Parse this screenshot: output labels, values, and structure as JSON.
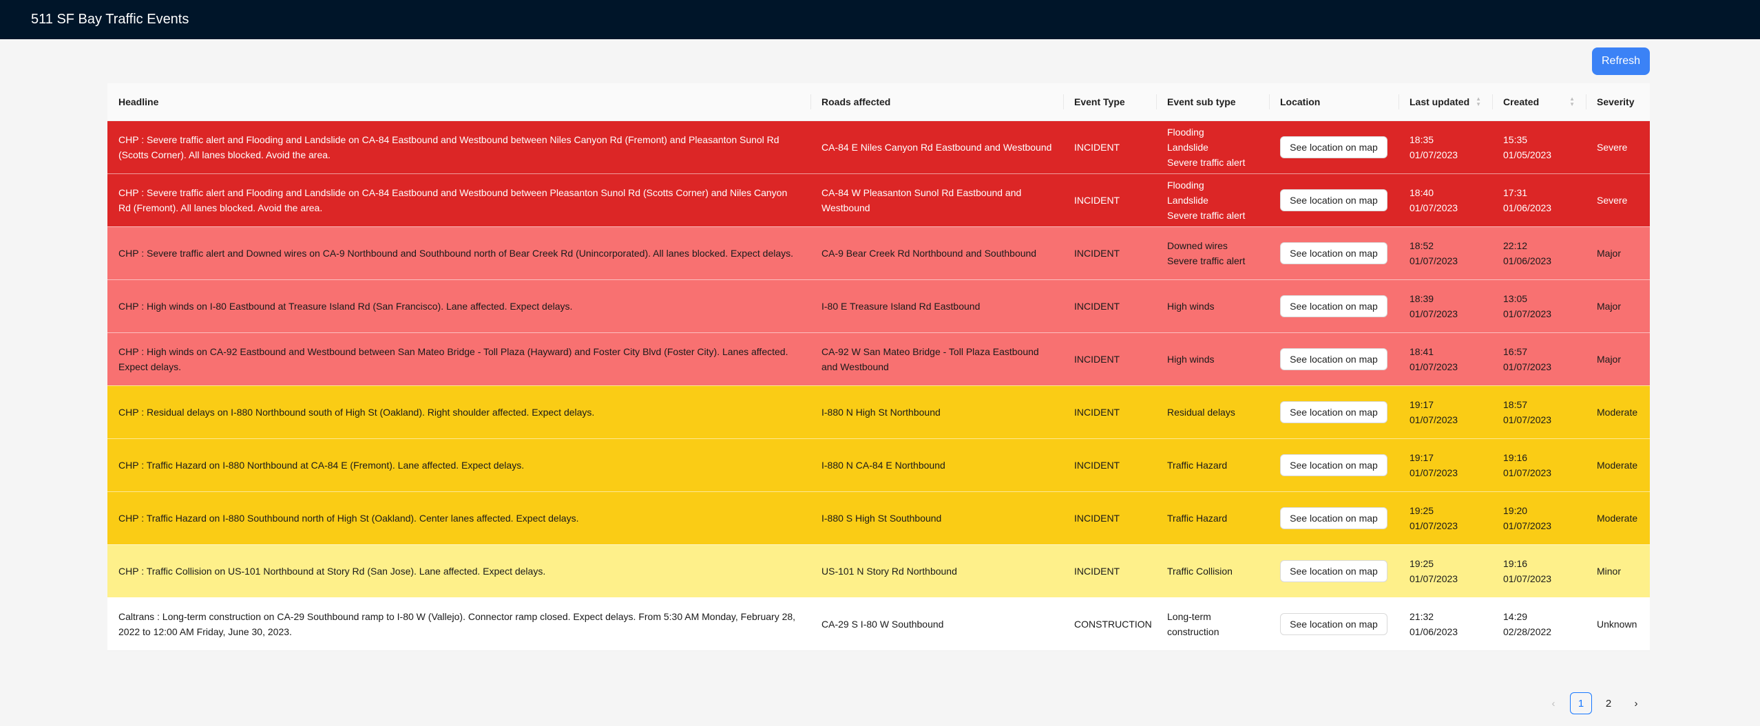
{
  "app": {
    "title": "511 SF Bay Traffic Events"
  },
  "toolbar": {
    "refresh_label": "Refresh"
  },
  "table": {
    "columns": [
      "Headline",
      "Roads affected",
      "Event Type",
      "Event sub type",
      "Location",
      "Last updated",
      "Created",
      "Severity"
    ],
    "map_button_label": "See location on map",
    "rows": [
      {
        "severity_class": "severe",
        "headline": "CHP : Severe traffic alert and Flooding and Landslide on CA-84 Eastbound and Westbound between Niles Canyon Rd (Fremont) and Pleasanton Sunol Rd (Scotts Corner). All lanes blocked. Avoid the area.",
        "roads": "CA-84 E Niles Canyon Rd Eastbound and Westbound",
        "event_type": "INCIDENT",
        "subtypes": [
          "Flooding",
          "Landslide",
          "Severe traffic alert"
        ],
        "updated_time": "18:35",
        "updated_date": "01/07/2023",
        "created_time": "15:35",
        "created_date": "01/05/2023",
        "severity": "Severe"
      },
      {
        "severity_class": "severe",
        "headline": "CHP : Severe traffic alert and Flooding and Landslide on CA-84 Eastbound and Westbound between Pleasanton Sunol Rd (Scotts Corner) and Niles Canyon Rd (Fremont). All lanes blocked. Avoid the area.",
        "roads": "CA-84 W Pleasanton Sunol Rd Eastbound and Westbound",
        "event_type": "INCIDENT",
        "subtypes": [
          "Flooding",
          "Landslide",
          "Severe traffic alert"
        ],
        "updated_time": "18:40",
        "updated_date": "01/07/2023",
        "created_time": "17:31",
        "created_date": "01/06/2023",
        "severity": "Severe"
      },
      {
        "severity_class": "major",
        "headline": "CHP : Severe traffic alert and Downed wires on CA-9 Northbound and Southbound north of Bear Creek Rd (Unincorporated). All lanes blocked. Expect delays.",
        "roads": "CA-9 Bear Creek Rd Northbound and Southbound",
        "event_type": "INCIDENT",
        "subtypes": [
          "Downed wires",
          "Severe traffic alert"
        ],
        "updated_time": "18:52",
        "updated_date": "01/07/2023",
        "created_time": "22:12",
        "created_date": "01/06/2023",
        "severity": "Major"
      },
      {
        "severity_class": "major",
        "headline": "CHP : High winds on I-80 Eastbound at Treasure Island Rd (San Francisco). Lane affected. Expect delays.",
        "roads": "I-80 E Treasure Island Rd Eastbound",
        "event_type": "INCIDENT",
        "subtypes": [
          "High winds"
        ],
        "updated_time": "18:39",
        "updated_date": "01/07/2023",
        "created_time": "13:05",
        "created_date": "01/07/2023",
        "severity": "Major"
      },
      {
        "severity_class": "major",
        "headline": "CHP : High winds on CA-92 Eastbound and Westbound between San Mateo Bridge - Toll Plaza (Hayward) and Foster City Blvd (Foster City). Lanes affected. Expect delays.",
        "roads": "CA-92 W San Mateo Bridge - Toll Plaza Eastbound and Westbound",
        "event_type": "INCIDENT",
        "subtypes": [
          "High winds"
        ],
        "updated_time": "18:41",
        "updated_date": "01/07/2023",
        "created_time": "16:57",
        "created_date": "01/07/2023",
        "severity": "Major"
      },
      {
        "severity_class": "moderate",
        "headline": "CHP : Residual delays on I-880 Northbound south of High St (Oakland). Right shoulder affected. Expect delays.",
        "roads": "I-880 N High St Northbound",
        "event_type": "INCIDENT",
        "subtypes": [
          "Residual delays"
        ],
        "updated_time": "19:17",
        "updated_date": "01/07/2023",
        "created_time": "18:57",
        "created_date": "01/07/2023",
        "severity": "Moderate"
      },
      {
        "severity_class": "moderate",
        "headline": "CHP : Traffic Hazard on I-880 Northbound at CA-84 E (Fremont). Lane affected. Expect delays.",
        "roads": "I-880 N CA-84 E Northbound",
        "event_type": "INCIDENT",
        "subtypes": [
          "Traffic Hazard"
        ],
        "updated_time": "19:17",
        "updated_date": "01/07/2023",
        "created_time": "19:16",
        "created_date": "01/07/2023",
        "severity": "Moderate"
      },
      {
        "severity_class": "moderate",
        "headline": "CHP : Traffic Hazard on I-880 Southbound north of High St (Oakland). Center lanes affected. Expect delays.",
        "roads": "I-880 S High St Southbound",
        "event_type": "INCIDENT",
        "subtypes": [
          "Traffic Hazard"
        ],
        "updated_time": "19:25",
        "updated_date": "01/07/2023",
        "created_time": "19:20",
        "created_date": "01/07/2023",
        "severity": "Moderate"
      },
      {
        "severity_class": "minor",
        "headline": "CHP : Traffic Collision on US-101 Northbound at Story Rd (San Jose). Lane affected. Expect delays.",
        "roads": "US-101 N Story Rd Northbound",
        "event_type": "INCIDENT",
        "subtypes": [
          "Traffic Collision"
        ],
        "updated_time": "19:25",
        "updated_date": "01/07/2023",
        "created_time": "19:16",
        "created_date": "01/07/2023",
        "severity": "Minor"
      },
      {
        "severity_class": "unknown",
        "headline": "Caltrans : Long-term construction on CA-29 Southbound ramp to I-80 W (Vallejo). Connector ramp closed. Expect delays. From 5:30 AM Monday, February 28, 2022 to 12:00 AM Friday, June 30, 2023.",
        "roads": "CA-29 S I-80 W Southbound",
        "event_type": "CONSTRUCTION",
        "subtypes": [
          "Long-term construction"
        ],
        "updated_time": "21:32",
        "updated_date": "01/06/2023",
        "created_time": "14:29",
        "created_date": "02/28/2022",
        "severity": "Unknown"
      }
    ]
  },
  "pagination": {
    "prev_icon": "chevron-left-icon",
    "next_icon": "chevron-right-icon",
    "pages": [
      "1",
      "2"
    ],
    "current": "1"
  }
}
